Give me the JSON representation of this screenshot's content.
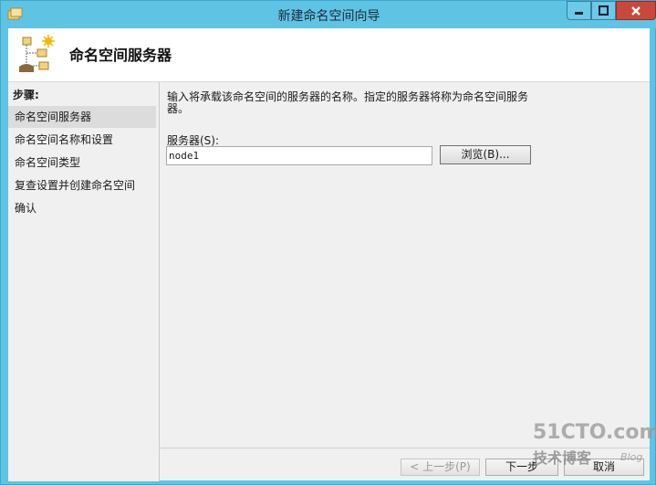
{
  "window": {
    "title": "新建命名空间向导",
    "controls": [
      "minimize",
      "maximize",
      "close"
    ]
  },
  "header": {
    "title": "命名空间服务器",
    "icon": "namespace-wizard-icon"
  },
  "steps": {
    "heading": "步骤:",
    "items": [
      {
        "label": "命名空间服务器",
        "active": true
      },
      {
        "label": "命名空间名称和设置",
        "active": false
      },
      {
        "label": "命名空间类型",
        "active": false
      },
      {
        "label": "复查设置并创建命名空间",
        "active": false
      },
      {
        "label": "确认",
        "active": false
      }
    ]
  },
  "main": {
    "description": "输入将承载该命名空间的服务器的名称。指定的服务器将称为命名空间服务器。",
    "server_label": "服务器(S):",
    "server_value": "node1",
    "browse_label": "浏览(B)..."
  },
  "footer": {
    "prev_label": "< 上一步(P)",
    "next_label": "下一步",
    "cancel_label": "取消",
    "prev_enabled": false
  },
  "watermark": {
    "main": "51CTO.com",
    "sub": "技术博客",
    "blog": "Blog"
  },
  "colors": {
    "titlebar": "#5fc3e4",
    "close_button": "#c9483c",
    "content_bg": "#f0f0f0",
    "active_step_bg": "#dcdcdc"
  }
}
